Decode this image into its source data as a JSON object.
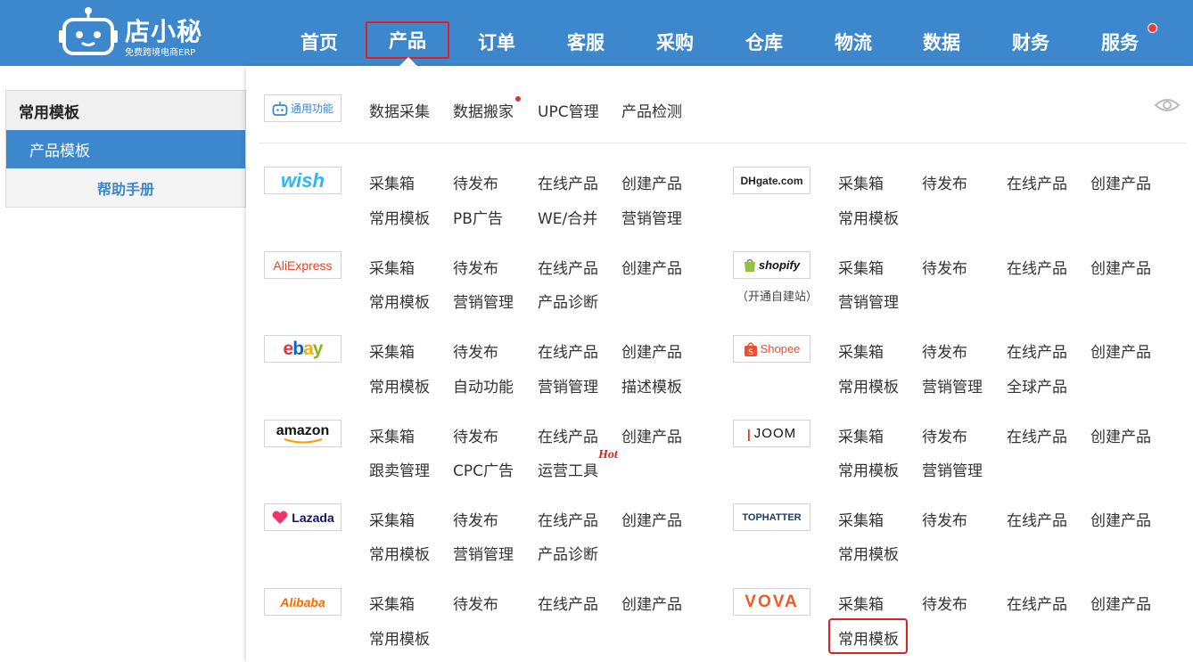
{
  "app": {
    "logo_title": "店小秘",
    "logo_sub": "免费跨境电商ERP"
  },
  "nav": {
    "items": [
      "首页",
      "产品",
      "订单",
      "客服",
      "采购",
      "仓库",
      "物流",
      "数据",
      "财务",
      "服务"
    ],
    "active": "产品"
  },
  "sidebar": {
    "header": "常用模板",
    "active_item": "产品模板",
    "help": "帮助手册"
  },
  "general": {
    "badge": "通用功能",
    "links": [
      "数据采集",
      "数据搬家",
      "UPC管理",
      "产品检测"
    ]
  },
  "platforms_left": [
    {
      "name": "wish",
      "links": [
        "采集箱",
        "待发布",
        "在线产品",
        "创建产品",
        "常用模板",
        "PB广告",
        "WE/合并",
        "营销管理"
      ]
    },
    {
      "name": "AliExpress",
      "links": [
        "采集箱",
        "待发布",
        "在线产品",
        "创建产品",
        "常用模板",
        "营销管理",
        "产品诊断"
      ]
    },
    {
      "name": "ebay",
      "links": [
        "采集箱",
        "待发布",
        "在线产品",
        "创建产品",
        "常用模板",
        "自动功能",
        "营销管理",
        "描述模板"
      ]
    },
    {
      "name": "amazon",
      "links": [
        "采集箱",
        "待发布",
        "在线产品",
        "创建产品",
        "跟卖管理",
        "CPC广告",
        "运营工具"
      ]
    },
    {
      "name": "Lazada",
      "links": [
        "采集箱",
        "待发布",
        "在线产品",
        "创建产品",
        "常用模板",
        "营销管理",
        "产品诊断"
      ]
    },
    {
      "name": "Alibaba",
      "links": [
        "采集箱",
        "待发布",
        "在线产品",
        "创建产品",
        "常用模板"
      ]
    }
  ],
  "platforms_right": [
    {
      "name": "DHgate.com",
      "links": [
        "采集箱",
        "待发布",
        "在线产品",
        "创建产品",
        "常用模板"
      ]
    },
    {
      "name": "shopify",
      "sub": "（开通自建站）",
      "links": [
        "采集箱",
        "待发布",
        "在线产品",
        "创建产品",
        "营销管理"
      ]
    },
    {
      "name": "Shopee",
      "links": [
        "采集箱",
        "待发布",
        "在线产品",
        "创建产品",
        "常用模板",
        "营销管理",
        "全球产品"
      ]
    },
    {
      "name": "JOOM",
      "links": [
        "采集箱",
        "待发布",
        "在线产品",
        "创建产品",
        "常用模板",
        "营销管理"
      ]
    },
    {
      "name": "TOPHATTER",
      "links": [
        "采集箱",
        "待发布",
        "在线产品",
        "创建产品",
        "常用模板"
      ]
    },
    {
      "name": "VOVA",
      "links": [
        "采集箱",
        "待发布",
        "在线产品",
        "创建产品",
        "常用模板"
      ]
    }
  ],
  "hot_label": "Hot",
  "colors": {
    "brand": "#3d87cd",
    "highlight": "#e02020"
  }
}
